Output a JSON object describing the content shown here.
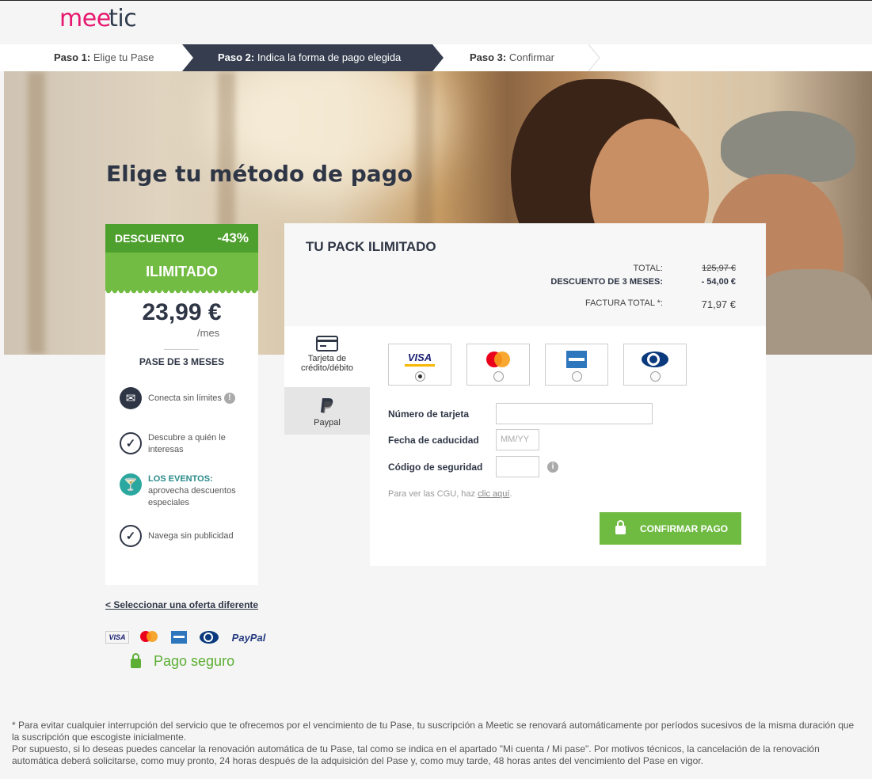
{
  "brand": {
    "logo_pink": "me",
    "logo_mid": "e",
    "logo_dark": "tic"
  },
  "steps": [
    {
      "num": "Paso 1:",
      "label": "Elige tu Pase"
    },
    {
      "num": "Paso 2:",
      "label": "Indica la forma de pago elegida"
    },
    {
      "num": "Paso 3:",
      "label": "Confirmar"
    }
  ],
  "hero": {
    "title": "Elige tu método de pago"
  },
  "offer": {
    "discount_label": "DESCUENTO",
    "discount_pct": "-43%",
    "plan": "ILIMITADO",
    "price": "23,99 €",
    "per": "/mes",
    "pase": "PASE DE 3 MESES",
    "features": [
      {
        "icon": "envelope-icon",
        "text": "Conecta sin límites"
      },
      {
        "icon": "check-icon",
        "text": "Descubre a quién le interesas"
      },
      {
        "icon": "cocktail-icon",
        "bold": "LOS EVENTOS:",
        "text": "aprovecha descuentos especiales"
      },
      {
        "icon": "check-icon",
        "text": "Navega sin publicidad"
      }
    ]
  },
  "other_offer": "< Seleccionar una oferta diferente",
  "secure": "Pago seguro",
  "pack": {
    "title": "TU PACK ILIMITADO",
    "total_label": "TOTAL:",
    "total_value": "125,97 €",
    "discount_label": "DESCUENTO DE 3 MESES:",
    "discount_value": "- 54,00 €",
    "invoice_label": "FACTURA TOTAL *:",
    "invoice_value": "71,97 €"
  },
  "tabs": {
    "card_line1": "Tarjeta de",
    "card_line2": "crédito/débito",
    "paypal": "Paypal"
  },
  "cards": {
    "visa": "VISA",
    "selected": "visa"
  },
  "form": {
    "card_number_label": "Número de tarjeta",
    "expiry_label": "Fecha de caducidad",
    "expiry_placeholder": "MM/YY",
    "cvv_label": "Código de seguridad",
    "cgu_text": "Para ver las CGU, haz ",
    "cgu_link": "clic aquí",
    "cgu_end": ".",
    "confirm": "CONFIRMAR PAGO"
  },
  "mini_logos": {
    "visa": "VISA",
    "paypal": "PayPal"
  },
  "footer": {
    "line1": "* Para evitar cualquier interrupción del servicio que te ofrecemos por el vencimiento de tu Pase, tu suscripción a Meetic se renovará automáticamente por períodos sucesivos de la misma duración que la suscripción que escogiste inicialmente.",
    "line2": "Por supuesto, si lo deseas puedes cancelar la renovación automática de tu Pase, tal como se indica en el apartado \"Mi cuenta / Mi pase\". Por motivos técnicos, la cancelación de la renovación automática deberá solicitarse, como muy pronto, 24 horas después de la adquisición del Pase y, como muy tarde, 48 horas antes del vencimiento del Pase en vigor."
  },
  "colors": {
    "green": "#73bc44",
    "dark_green": "#4ea02e",
    "navy": "#2e3545",
    "pink": "#e6186f"
  }
}
